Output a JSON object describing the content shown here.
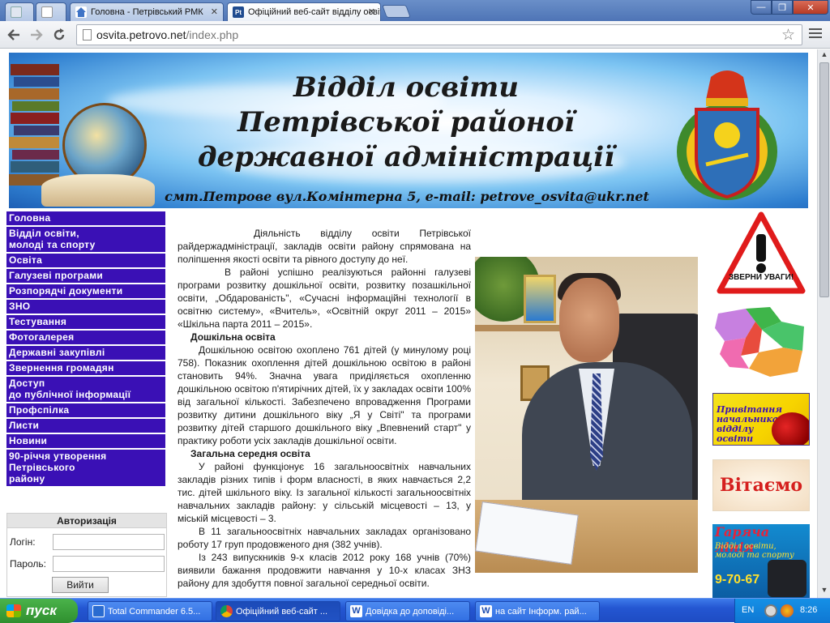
{
  "browser": {
    "tabs": [
      {
        "label": ""
      },
      {
        "label": ""
      },
      {
        "label": "Головна - Петрівський РМК"
      },
      {
        "label": "Офіційний веб-сайт відділу освіти"
      }
    ],
    "url_domain": "osvita.petrovo.net",
    "url_path": "/index.php",
    "icons": [
      "back-arrow-icon",
      "forward-arrow-icon",
      "reload-icon",
      "bookmark-star-icon",
      "menu-icon"
    ]
  },
  "banner": {
    "title_line1": "Відділ освіти",
    "title_line2": "Петрівської районої",
    "title_line3": "державної адміністрації",
    "address": "смт.Петрове вул.Комінтерна 5, e-mail: petrove_osvita@ukr.net"
  },
  "nav": {
    "items": [
      {
        "label": "Головна"
      },
      {
        "label": "Відділ освіти,\nмолоді та спорту"
      },
      {
        "label": "Освіта"
      },
      {
        "label": "Галузеві програми"
      },
      {
        "label": "Розпорядчі документи"
      },
      {
        "label": "ЗНО"
      },
      {
        "label": "Тестування"
      },
      {
        "label": "Фотогалерея"
      },
      {
        "label": "Державні закупівлі"
      },
      {
        "label": "Звернення громадян"
      },
      {
        "label": "Доступ\nдо публічної інформації"
      },
      {
        "label": "Профспілка"
      },
      {
        "label": "Листи"
      },
      {
        "label": "Новини"
      },
      {
        "label": "90-річчя утворення\nПетрівського\nрайону"
      }
    ]
  },
  "auth": {
    "header": "Авторизація",
    "login_label": "Логін:",
    "password_label": "Пароль:",
    "login_value": "",
    "password_value": "",
    "submit_label": "Вийти"
  },
  "content": {
    "p1": "Діяльність відділу освіти Петрівської райдержадміністрації, закладів освіти району спрямована на поліпшення якості освіти та рівного доступу до неї.",
    "p2": "В районі успішно реалізуються районні галузеві програми розвитку дошкільної освіти, розвитку позашкільної освіти, „Обдарованість\", «Сучасні інформаційні технології в освітню систему», «Вчитель», «Освітній округ 2011 – 2015» «Шкільна парта 2011 – 2015».",
    "h1": "Дошкільна освіта",
    "p3": "Дошкільною освітою охоплено 761 дітей (у минулому році 758). Показник охоплення дітей дошкільною освітою в районі становить 94%. Значна увага приділяється охопленню дошкільною освітою п'ятирічних дітей, їх у закладах освіти 100% від загальної кількості. Забезпечено впровадження Програми розвитку дитини дошкільного віку „Я у Світі\" та програми розвитку дітей старшого дошкільного віку „Впевнений старт\" у практику роботи усіх закладів дошкільної освіти.",
    "h2": "Загальна середня освіта",
    "p4": "У районі функціонує 16 загальноосвітніх навчальних закладів різних типів і форм власності, в яких навчається 2,2 тис. дітей шкільного віку. Із загальної кількості загальноосвітніх навчальних закладів району: у сільській місцевості – 13, у міській місцевості – 3.",
    "p5": "В 11 загальноосвітніх навчальних закладах організовано роботу 17 груп продовженого дня (382 учнів).",
    "p6": "Із 243 випускників 9-х класів 2012 року 168 учнів (70%) виявили бажання продовжити навчання у 10-х класах ЗНЗ району для здобуття повної загальної середньої освіти."
  },
  "right": {
    "sign_text": "ЗВЕРНИ УВАГИ!",
    "greeting_banner": "Привітання начальника відділу освіти",
    "welcome_banner": "Вітаємо",
    "hotline_title": "Гаряча лінія",
    "hotline_sub": "Відділ освіти, молоді та спорту",
    "hotline_phone": "9-70-67"
  },
  "taskbar": {
    "start_label": "пуск",
    "tasks": [
      {
        "label": "Total Commander 6.5..."
      },
      {
        "label": "Офіційний веб-сайт ..."
      },
      {
        "label": "Довідка до доповіді..."
      },
      {
        "label": "на сайт Інформ. рай..."
      }
    ],
    "lang": "EN",
    "clock": "8:26"
  },
  "colors": {
    "nav_bg": "#3a10b5",
    "nav_text": "#ffffff",
    "tabbar": "#5b80c0",
    "taskbar": "#2456d2"
  }
}
